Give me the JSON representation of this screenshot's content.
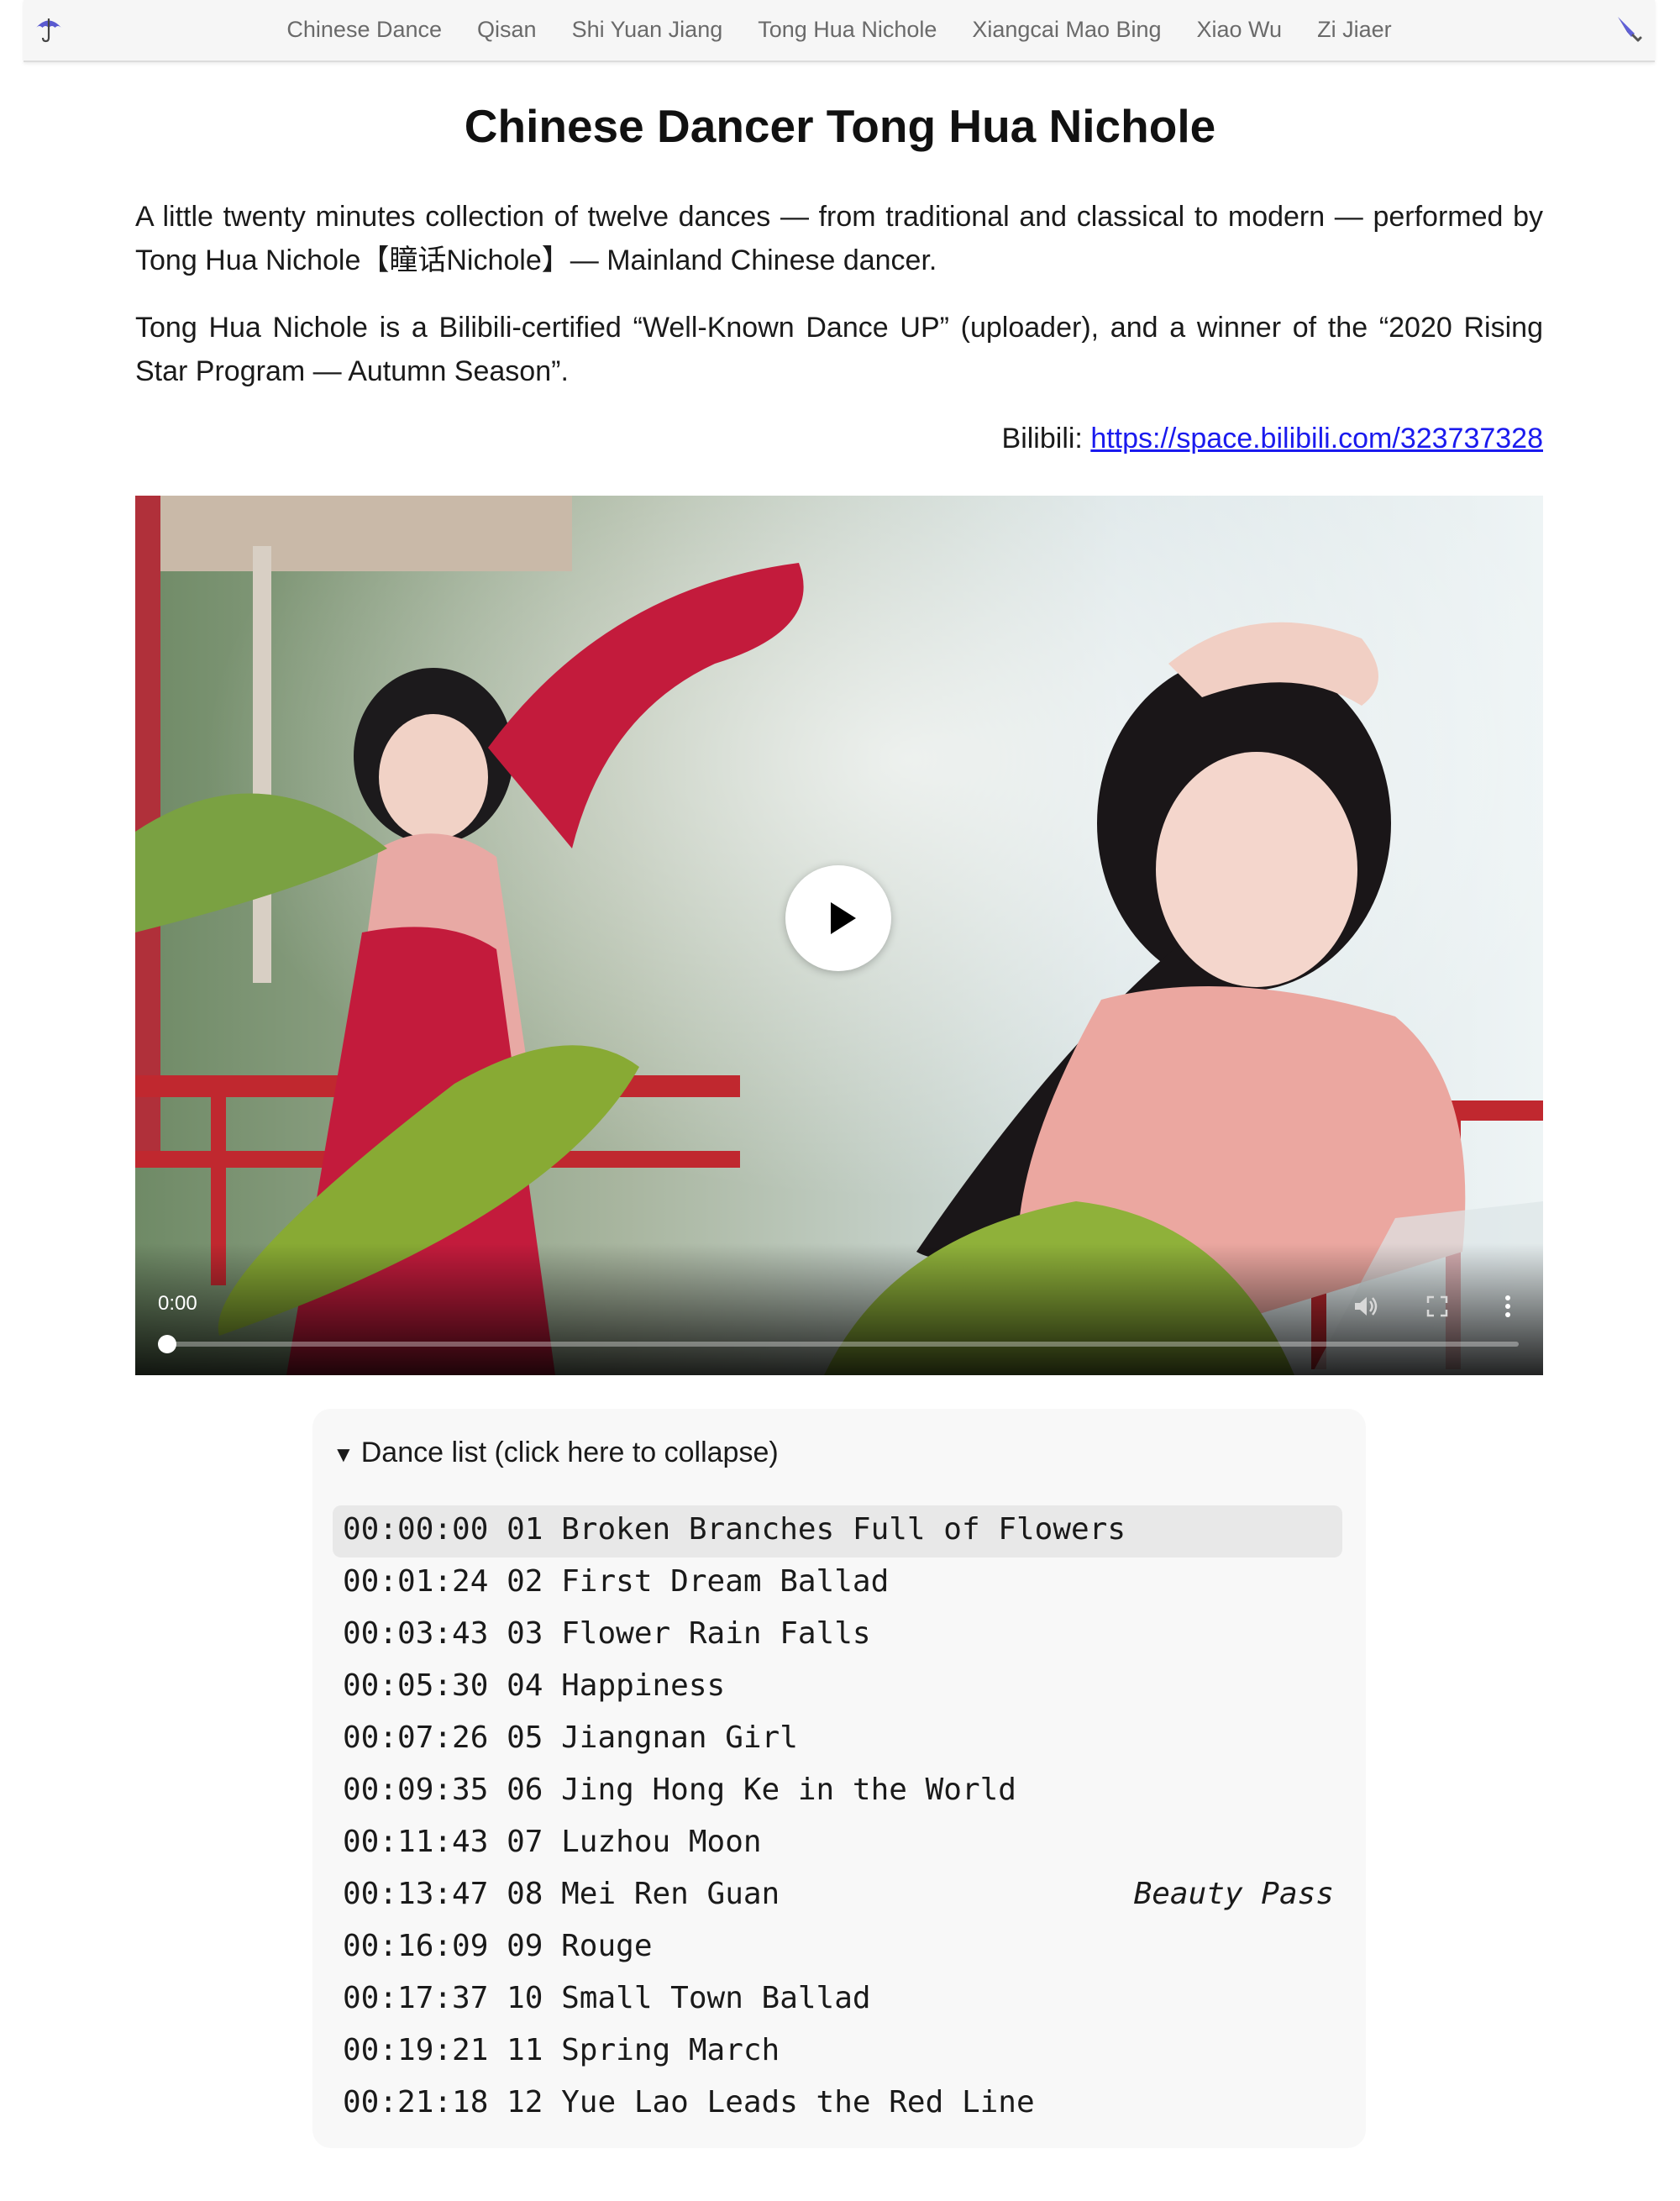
{
  "nav": {
    "items": [
      "Chinese Dance",
      "Qisan",
      "Shi Yuan Jiang",
      "Tong Hua Nichole",
      "Xiangcai Mao Bing",
      "Xiao Wu",
      "Zi Jiaer"
    ],
    "left_icon": "umbrella-icon",
    "right_icon": "closed-umbrella-icon"
  },
  "page": {
    "title": "Chinese Dancer Tong Hua Nichole",
    "paragraph1": "A little twenty minutes collection of twelve dances — from traditional and classical to modern — performed by Tong Hua Nichole【瞳话Nichole】— Mainland Chinese dancer.",
    "paragraph2": "Tong Hua Nichole is a Bilibili-certified “Well-Known Dance UP” (uploader), and a winner of the “2020 Rising Star Program — Autumn Season”.",
    "bilibili_label": "Bilibili: ",
    "bilibili_url": "https://space.bilibili.com/323737328"
  },
  "video": {
    "current_time": "0:00",
    "progress": 0,
    "icons": [
      "play-icon",
      "volume-icon",
      "fullscreen-icon",
      "more-options-icon"
    ]
  },
  "dance_list": {
    "summary": "Dance list (click here to collapse)",
    "entries": [
      {
        "time": "00:00:00",
        "num": "01",
        "title": "Broken Branches Full of Flowers",
        "note": ""
      },
      {
        "time": "00:01:24",
        "num": "02",
        "title": "First Dream Ballad",
        "note": ""
      },
      {
        "time": "00:03:43",
        "num": "03",
        "title": "Flower Rain Falls",
        "note": ""
      },
      {
        "time": "00:05:30",
        "num": "04",
        "title": "Happiness",
        "note": ""
      },
      {
        "time": "00:07:26",
        "num": "05",
        "title": "Jiangnan Girl",
        "note": ""
      },
      {
        "time": "00:09:35",
        "num": "06",
        "title": "Jing Hong Ke in the World",
        "note": ""
      },
      {
        "time": "00:11:43",
        "num": "07",
        "title": "Luzhou Moon",
        "note": ""
      },
      {
        "time": "00:13:47",
        "num": "08",
        "title": "Mei Ren Guan",
        "note": "Beauty Pass"
      },
      {
        "time": "00:16:09",
        "num": "09",
        "title": "Rouge",
        "note": ""
      },
      {
        "time": "00:17:37",
        "num": "10",
        "title": "Small Town Ballad",
        "note": ""
      },
      {
        "time": "00:19:21",
        "num": "11",
        "title": "Spring March",
        "note": ""
      },
      {
        "time": "00:21:18",
        "num": "12",
        "title": "Yue Lao Leads the Red Line",
        "note": ""
      }
    ]
  }
}
